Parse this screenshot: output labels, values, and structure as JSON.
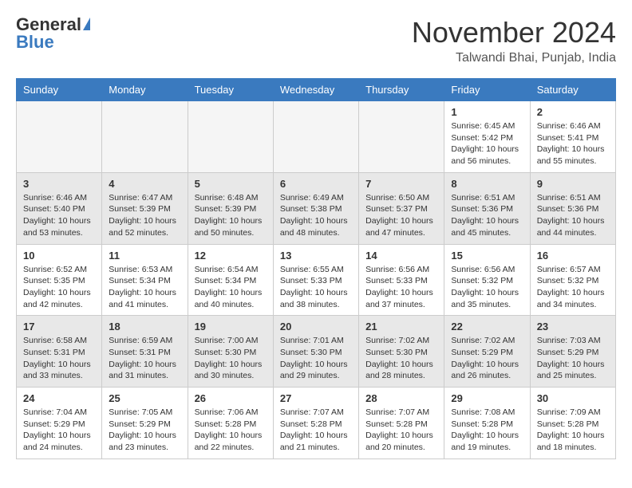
{
  "header": {
    "logo_general": "General",
    "logo_blue": "Blue",
    "month": "November 2024",
    "location": "Talwandi Bhai, Punjab, India"
  },
  "weekdays": [
    "Sunday",
    "Monday",
    "Tuesday",
    "Wednesday",
    "Thursday",
    "Friday",
    "Saturday"
  ],
  "weeks": [
    [
      {
        "day": "",
        "info": ""
      },
      {
        "day": "",
        "info": ""
      },
      {
        "day": "",
        "info": ""
      },
      {
        "day": "",
        "info": ""
      },
      {
        "day": "",
        "info": ""
      },
      {
        "day": "1",
        "info": "Sunrise: 6:45 AM\nSunset: 5:42 PM\nDaylight: 10 hours\nand 56 minutes."
      },
      {
        "day": "2",
        "info": "Sunrise: 6:46 AM\nSunset: 5:41 PM\nDaylight: 10 hours\nand 55 minutes."
      }
    ],
    [
      {
        "day": "3",
        "info": "Sunrise: 6:46 AM\nSunset: 5:40 PM\nDaylight: 10 hours\nand 53 minutes."
      },
      {
        "day": "4",
        "info": "Sunrise: 6:47 AM\nSunset: 5:39 PM\nDaylight: 10 hours\nand 52 minutes."
      },
      {
        "day": "5",
        "info": "Sunrise: 6:48 AM\nSunset: 5:39 PM\nDaylight: 10 hours\nand 50 minutes."
      },
      {
        "day": "6",
        "info": "Sunrise: 6:49 AM\nSunset: 5:38 PM\nDaylight: 10 hours\nand 48 minutes."
      },
      {
        "day": "7",
        "info": "Sunrise: 6:50 AM\nSunset: 5:37 PM\nDaylight: 10 hours\nand 47 minutes."
      },
      {
        "day": "8",
        "info": "Sunrise: 6:51 AM\nSunset: 5:36 PM\nDaylight: 10 hours\nand 45 minutes."
      },
      {
        "day": "9",
        "info": "Sunrise: 6:51 AM\nSunset: 5:36 PM\nDaylight: 10 hours\nand 44 minutes."
      }
    ],
    [
      {
        "day": "10",
        "info": "Sunrise: 6:52 AM\nSunset: 5:35 PM\nDaylight: 10 hours\nand 42 minutes."
      },
      {
        "day": "11",
        "info": "Sunrise: 6:53 AM\nSunset: 5:34 PM\nDaylight: 10 hours\nand 41 minutes."
      },
      {
        "day": "12",
        "info": "Sunrise: 6:54 AM\nSunset: 5:34 PM\nDaylight: 10 hours\nand 40 minutes."
      },
      {
        "day": "13",
        "info": "Sunrise: 6:55 AM\nSunset: 5:33 PM\nDaylight: 10 hours\nand 38 minutes."
      },
      {
        "day": "14",
        "info": "Sunrise: 6:56 AM\nSunset: 5:33 PM\nDaylight: 10 hours\nand 37 minutes."
      },
      {
        "day": "15",
        "info": "Sunrise: 6:56 AM\nSunset: 5:32 PM\nDaylight: 10 hours\nand 35 minutes."
      },
      {
        "day": "16",
        "info": "Sunrise: 6:57 AM\nSunset: 5:32 PM\nDaylight: 10 hours\nand 34 minutes."
      }
    ],
    [
      {
        "day": "17",
        "info": "Sunrise: 6:58 AM\nSunset: 5:31 PM\nDaylight: 10 hours\nand 33 minutes."
      },
      {
        "day": "18",
        "info": "Sunrise: 6:59 AM\nSunset: 5:31 PM\nDaylight: 10 hours\nand 31 minutes."
      },
      {
        "day": "19",
        "info": "Sunrise: 7:00 AM\nSunset: 5:30 PM\nDaylight: 10 hours\nand 30 minutes."
      },
      {
        "day": "20",
        "info": "Sunrise: 7:01 AM\nSunset: 5:30 PM\nDaylight: 10 hours\nand 29 minutes."
      },
      {
        "day": "21",
        "info": "Sunrise: 7:02 AM\nSunset: 5:30 PM\nDaylight: 10 hours\nand 28 minutes."
      },
      {
        "day": "22",
        "info": "Sunrise: 7:02 AM\nSunset: 5:29 PM\nDaylight: 10 hours\nand 26 minutes."
      },
      {
        "day": "23",
        "info": "Sunrise: 7:03 AM\nSunset: 5:29 PM\nDaylight: 10 hours\nand 25 minutes."
      }
    ],
    [
      {
        "day": "24",
        "info": "Sunrise: 7:04 AM\nSunset: 5:29 PM\nDaylight: 10 hours\nand 24 minutes."
      },
      {
        "day": "25",
        "info": "Sunrise: 7:05 AM\nSunset: 5:29 PM\nDaylight: 10 hours\nand 23 minutes."
      },
      {
        "day": "26",
        "info": "Sunrise: 7:06 AM\nSunset: 5:28 PM\nDaylight: 10 hours\nand 22 minutes."
      },
      {
        "day": "27",
        "info": "Sunrise: 7:07 AM\nSunset: 5:28 PM\nDaylight: 10 hours\nand 21 minutes."
      },
      {
        "day": "28",
        "info": "Sunrise: 7:07 AM\nSunset: 5:28 PM\nDaylight: 10 hours\nand 20 minutes."
      },
      {
        "day": "29",
        "info": "Sunrise: 7:08 AM\nSunset: 5:28 PM\nDaylight: 10 hours\nand 19 minutes."
      },
      {
        "day": "30",
        "info": "Sunrise: 7:09 AM\nSunset: 5:28 PM\nDaylight: 10 hours\nand 18 minutes."
      }
    ]
  ]
}
